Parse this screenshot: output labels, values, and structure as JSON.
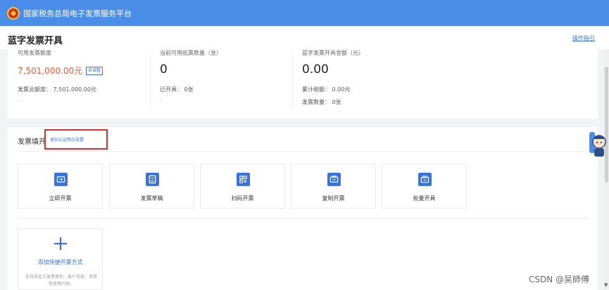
{
  "header": {
    "title": "国家税务总局电子发票服务平台"
  },
  "page": {
    "title": "蓝字发票开具",
    "guide": "操作指引"
  },
  "stats": {
    "quota_label": "可用发票额度",
    "quota_value": "7,501,000.00元",
    "adjust_label": "去调整",
    "total_quota_label": "发票总额度：",
    "total_quota_value": "7,501,000.00元",
    "quota_dash": "-",
    "paper_label": "当前可用纸票数量（张）",
    "paper_value": "0",
    "issued_label": "已开具：",
    "issued_value": "0张",
    "paper_dash": "-",
    "amount_label": "蓝字发票开具金额（元）",
    "amount_value": "0.00",
    "tax_label": "累计税额：",
    "tax_value": "0.00元",
    "count_label": "发票数量：",
    "count_value": "0张"
  },
  "fill": {
    "title": "发票填开",
    "id_link": "身份认证频次设置",
    "actions": [
      {
        "label": "立即开票",
        "icon": "ticket-icon"
      },
      {
        "label": "发票草稿",
        "icon": "draft-icon"
      },
      {
        "label": "扫码开票",
        "icon": "qr-code-icon"
      },
      {
        "label": "复制开票",
        "icon": "copy-ticket-icon"
      },
      {
        "label": "批量开具",
        "icon": "batch-ticket-icon"
      }
    ],
    "add": {
      "label": "添加快捷开票方式",
      "desc": "支持自定义发票类型、客户信息、项目信息等内容。"
    }
  },
  "watermark": "CSDN @吴師傅",
  "colors": {
    "header": "#4a8eea",
    "accent": "#3a6fd8",
    "quota": "#e85a2f",
    "highlight": "#d9302b"
  }
}
